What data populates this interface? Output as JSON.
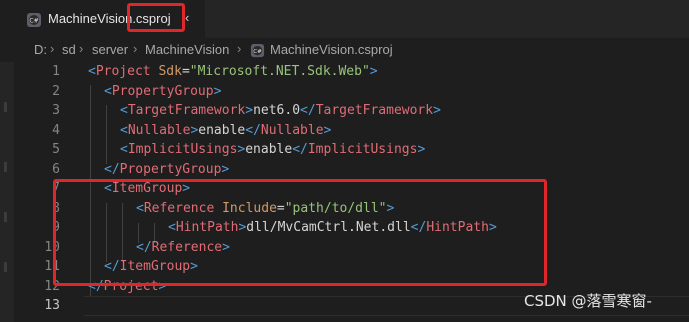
{
  "tab": {
    "icon": "csharp-project-icon",
    "filename_base": "MachineVision",
    "filename_ext": ".csproj",
    "close_glyph": "‹"
  },
  "breadcrumb": {
    "items": [
      "D:",
      "sd",
      "server",
      "MachineVision",
      "MachineVision.csproj"
    ],
    "separator": "›"
  },
  "editor": {
    "line_numbers": [
      "1",
      "2",
      "3",
      "4",
      "5",
      "6",
      "7",
      "8",
      "9",
      "10",
      "11",
      "12",
      "13"
    ],
    "active_line": "13"
  },
  "code": {
    "l1": {
      "tag": "Project",
      "attr": "Sdk",
      "value": "\"Microsoft.NET.Sdk.Web\""
    },
    "l2": {
      "tag": "PropertyGroup"
    },
    "l3": {
      "tag": "TargetFramework",
      "text": "net6.0"
    },
    "l4": {
      "tag": "Nullable",
      "text": "enable"
    },
    "l5": {
      "tag": "ImplicitUsings",
      "text": "enable"
    },
    "l6": {
      "tag": "PropertyGroup"
    },
    "l7": {
      "tag": "ItemGroup"
    },
    "l8": {
      "tag": "Reference",
      "attr": "Include",
      "value": "\"path/to/dll\""
    },
    "l9": {
      "tag": "HintPath",
      "text": "dll/MvCamCtrl.Net.dll"
    },
    "l10": {
      "tag": "Reference"
    },
    "l11": {
      "tag": "ItemGroup"
    },
    "l12": {
      "tag": "Project"
    }
  },
  "watermark": "CSDN @落雪寒窗-",
  "colors": {
    "highlight_box": "#e0252b",
    "tag": "#e06c75",
    "attribute": "#d19a66",
    "string": "#98c379",
    "bracket": "#569cd6"
  }
}
